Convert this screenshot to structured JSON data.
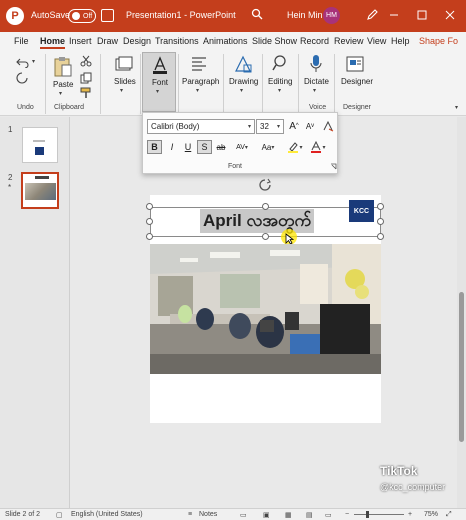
{
  "titlebar": {
    "autosave_label": "AutoSave",
    "toggle_state": "Off",
    "doc_title": "Presentation1",
    "separator": "-",
    "app_name": "PowerPoint",
    "user_name": "Hein Min",
    "user_initials": "HM"
  },
  "tabs": [
    "File",
    "Home",
    "Insert",
    "Draw",
    "Design",
    "Transitions",
    "Animations",
    "Slide Show",
    "Record",
    "Review",
    "View",
    "Help",
    "Shape Fo"
  ],
  "ribbon": {
    "undo_label": "Undo",
    "paste_label": "Paste",
    "clipboard_label": "Clipboard",
    "slides_label": "Slides",
    "font_label": "Font",
    "paragraph_label": "Paragraph",
    "drawing_label": "Drawing",
    "editing_label": "Editing",
    "dictate_label": "Dictate",
    "voice_label": "Voice",
    "designer_label": "Designer",
    "designer_group_label": "Designer"
  },
  "font_popup": {
    "font_name": "Calibri (Body)",
    "font_size": "32",
    "grow": "A",
    "shrink": "A",
    "bold": "B",
    "italic": "I",
    "underline": "U",
    "shadow": "S",
    "strike": "ab",
    "spacing": "AV",
    "case": "Aa",
    "label": "Font"
  },
  "slides_panel": {
    "slide1_number": "1",
    "slide2_number": "2",
    "slide2_marker": "*"
  },
  "slide": {
    "title_text": "April လအတွက်",
    "logo_text": "KCC"
  },
  "statusbar": {
    "slide_info": "Slide 2 of 2",
    "language": "English (United States)",
    "notes": "Notes",
    "zoom": "75%"
  },
  "watermark": {
    "app": "TikTok",
    "handle": "@kcc_computer"
  },
  "colors": {
    "accent": "#c43e1c",
    "ribbon_bg": "#f3f3f3",
    "canvas_bg": "#e9e9e9"
  }
}
